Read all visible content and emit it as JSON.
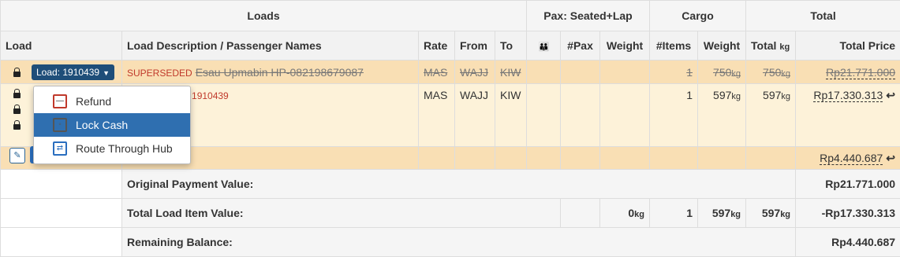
{
  "header_groups": {
    "loads": "Loads",
    "pax": "Pax: Seated+Lap",
    "cargo": "Cargo",
    "total": "Total"
  },
  "columns": {
    "load": "Load",
    "description": "Load Description / Passenger Names",
    "rate": "Rate",
    "from": "From",
    "to": "To",
    "pax_icon": "👪",
    "num_pax": "#Pax",
    "weight": "Weight",
    "num_items": "#Items",
    "cargo_weight": "Weight",
    "total_kg": "Total",
    "total_kg_unit": "kg",
    "total_price": "Total Price"
  },
  "rows": [
    {
      "load_button": "Load: 1910439",
      "status": "SUPERSEDED",
      "description": "Esau Upmabin HP-082198679087",
      "rate": "MAS",
      "from": "WAJJ",
      "to": "KIW",
      "items": "1",
      "weight": "750",
      "total_kg": "750",
      "unit": "kg",
      "price": "Rp21.771.000"
    },
    {
      "load_ref": "ad: 1910439",
      "rate": "MAS",
      "from": "WAJJ",
      "to": "KIW",
      "items": "1",
      "weight": "597",
      "total_kg": "597",
      "unit": "kg",
      "price": "Rp17.330.313"
    },
    {
      "price": "Rp4.440.687"
    }
  ],
  "summary": {
    "original_label": "Original Payment Value:",
    "original_value": "Rp21.771.000",
    "items_label": "Total Load Item Value:",
    "items_weight": "0",
    "items_count": "1",
    "items_cargo_weight": "597",
    "items_total_kg": "597",
    "items_unit": "kg",
    "items_value": "-Rp17.330.313",
    "remaining_label": "Remaining Balance:",
    "remaining_value": "Rp4.440.687"
  },
  "dropdown_menu": {
    "items": [
      {
        "label": "Refund",
        "icon": "minus-box-icon"
      },
      {
        "label": "Lock Cash",
        "icon": "lock-cash-icon",
        "active": true
      },
      {
        "label": "Route Through Hub",
        "icon": "route-hub-icon"
      }
    ]
  },
  "colors": {
    "superseded_row": "#f9dfb4",
    "current_row": "#fdf2d9",
    "accent_blue": "#2f6fb0",
    "status_red": "#c0392b"
  }
}
